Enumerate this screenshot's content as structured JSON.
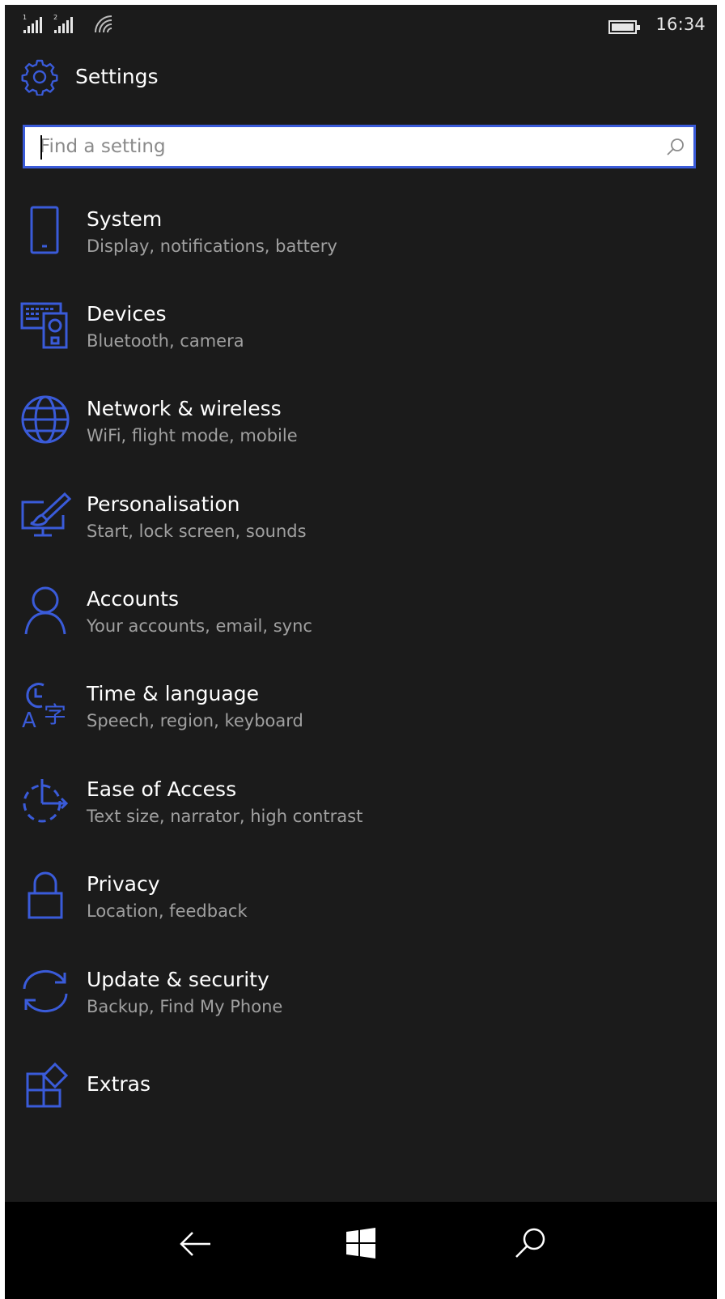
{
  "status_bar": {
    "sim1": "1",
    "sim2": "2",
    "time": "16:34",
    "icons": [
      "signal-sim1-icon",
      "signal-sim2-icon",
      "wifi-icon",
      "battery-icon"
    ]
  },
  "header": {
    "title": "Settings",
    "icon": "gear-icon"
  },
  "search": {
    "placeholder": "Find a setting",
    "value": "",
    "icon": "search-icon"
  },
  "accent_color": "#3a5bd9",
  "items": [
    {
      "label": "System",
      "description": "Display, notifications, battery",
      "icon": "phone-icon"
    },
    {
      "label": "Devices",
      "description": "Bluetooth, camera",
      "icon": "keyboard-speaker-icon"
    },
    {
      "label": "Network & wireless",
      "description": "WiFi, flight mode, mobile",
      "icon": "globe-icon"
    },
    {
      "label": "Personalisation",
      "description": "Start, lock screen, sounds",
      "icon": "monitor-brush-icon"
    },
    {
      "label": "Accounts",
      "description": "Your accounts, email, sync",
      "icon": "person-icon"
    },
    {
      "label": "Time & language",
      "description": "Speech, region, keyboard",
      "icon": "clock-language-icon"
    },
    {
      "label": "Ease of Access",
      "description": "Text size, narrator, high contrast",
      "icon": "ease-of-access-icon"
    },
    {
      "label": "Privacy",
      "description": "Location, feedback",
      "icon": "lock-icon"
    },
    {
      "label": "Update & security",
      "description": "Backup, Find My Phone",
      "icon": "sync-arrows-icon"
    },
    {
      "label": "Extras",
      "description": "",
      "icon": "extras-tiles-icon"
    }
  ],
  "nav_bar": {
    "buttons": [
      "back-arrow-icon",
      "windows-logo-icon",
      "search-icon"
    ]
  }
}
